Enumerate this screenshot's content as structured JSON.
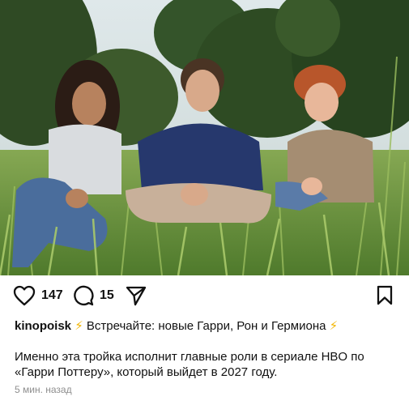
{
  "photo": {
    "description_icon": "photo"
  },
  "actions": {
    "likes": "147",
    "comments": "15"
  },
  "caption": {
    "username": "kinopoisk",
    "emoji_left": "⚡",
    "headline": "Встречайте: новые Гарри, Рон и Гермиона",
    "emoji_right": "⚡",
    "body": "Именно эта тройка исполнит главные роли в сериале HBO по «Гарри Поттеру», который выйдет в 2027 году."
  },
  "meta": {
    "timestamp": "5 мин. назад"
  },
  "colors": {
    "accent_bolt": "#f2b500",
    "muted_text": "#8e8e8e"
  }
}
